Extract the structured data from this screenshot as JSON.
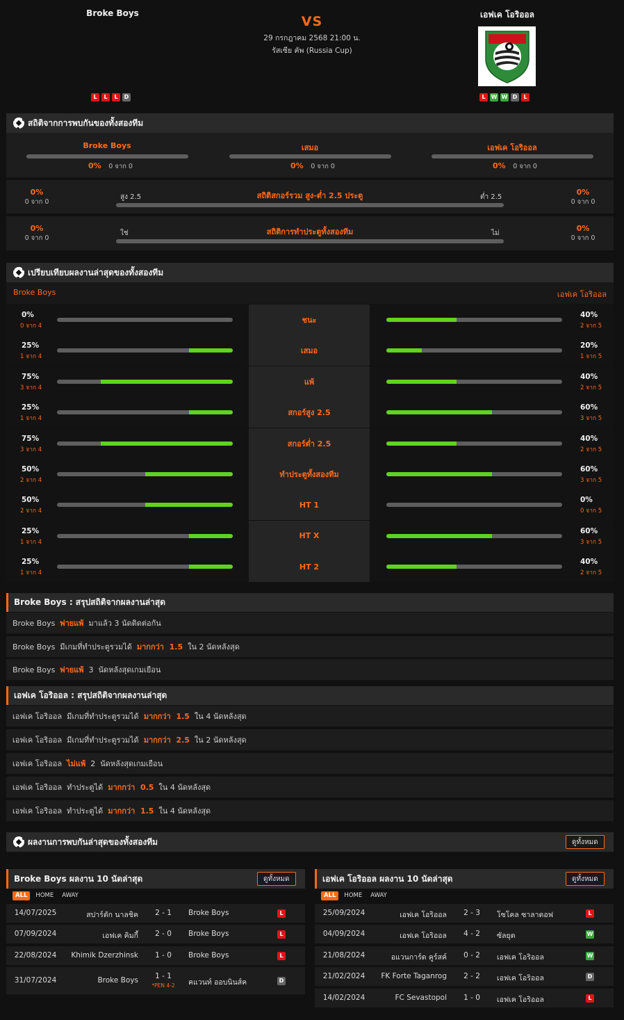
{
  "header": {
    "home_team": "Broke Boys",
    "away_team": "เอฟเค โอริออล",
    "vs": "VS",
    "datetime": "29 กรกฎาคม 2568 21:00 น.",
    "competition": "รัสเซีย คัพ (Russia Cup)",
    "home_form": [
      "L",
      "L",
      "L",
      "D"
    ],
    "away_form": [
      "L",
      "W",
      "W",
      "D",
      "L"
    ]
  },
  "h2h": {
    "title": "สถิติจากการพบกันของทั้งสองทีม",
    "cols": [
      {
        "label": "Broke Boys",
        "pct": "0%",
        "sub": "0 จาก 0",
        "fill": 0
      },
      {
        "label": "เสมอ",
        "pct": "0%",
        "sub": "0 จาก 0",
        "fill": 0
      },
      {
        "label": "เอฟเค โอริออล",
        "pct": "0%",
        "sub": "0 จาก 0",
        "fill": 0
      }
    ],
    "overunder": {
      "title": "สถิติสกอร์รวม สูง-ต่ำ 2.5 ประตู",
      "left_label": "สูง 2.5",
      "right_label": "ต่ำ 2.5",
      "left_pct": "0%",
      "left_sub": "0 จาก 0",
      "right_pct": "0%",
      "right_sub": "0 จาก 0"
    },
    "btts": {
      "title": "สถิติการทำประตูทั้งสองทีม",
      "left_label": "ใช่",
      "right_label": "ไม่",
      "left_pct": "0%",
      "left_sub": "0 จาก 0",
      "right_pct": "0%",
      "right_sub": "0 จาก 0"
    }
  },
  "compare": {
    "title": "เปรียบเทียบผลงานล่าสุดของทั้งสองทีม",
    "home": "Broke Boys",
    "away": "เอฟเค โอริออล",
    "rows": [
      {
        "label": "ชนะ",
        "l_pct": "0%",
        "l_sub": "0 จาก 4",
        "l_fill": 0,
        "r_pct": "40%",
        "r_sub": "2 จาก 5",
        "r_fill": 40
      },
      {
        "label": "เสมอ",
        "l_pct": "25%",
        "l_sub": "1 จาก 4",
        "l_fill": 25,
        "r_pct": "20%",
        "r_sub": "1 จาก 5",
        "r_fill": 20
      },
      {
        "label": "แพ้",
        "l_pct": "75%",
        "l_sub": "3 จาก 4",
        "l_fill": 75,
        "r_pct": "40%",
        "r_sub": "2 จาก 5",
        "r_fill": 40
      },
      {
        "label": "สกอร์สูง 2.5",
        "l_pct": "25%",
        "l_sub": "1 จาก 4",
        "l_fill": 25,
        "r_pct": "60%",
        "r_sub": "3 จาก 5",
        "r_fill": 60
      },
      {
        "label": "สกอร์ต่ำ 2.5",
        "l_pct": "75%",
        "l_sub": "3 จาก 4",
        "l_fill": 75,
        "r_pct": "40%",
        "r_sub": "2 จาก 5",
        "r_fill": 40
      },
      {
        "label": "ทำประตูทั้งสองทีม",
        "l_pct": "50%",
        "l_sub": "2 จาก 4",
        "l_fill": 50,
        "r_pct": "60%",
        "r_sub": "3 จาก 5",
        "r_fill": 60
      },
      {
        "label": "HT 1",
        "l_pct": "50%",
        "l_sub": "2 จาก 4",
        "l_fill": 50,
        "r_pct": "0%",
        "r_sub": "0 จาก 5",
        "r_fill": 0
      },
      {
        "label": "HT X",
        "l_pct": "25%",
        "l_sub": "1 จาก 4",
        "l_fill": 25,
        "r_pct": "60%",
        "r_sub": "3 จาก 5",
        "r_fill": 60
      },
      {
        "label": "HT 2",
        "l_pct": "25%",
        "l_sub": "1 จาก 4",
        "l_fill": 25,
        "r_pct": "40%",
        "r_sub": "2 จาก 5",
        "r_fill": 40
      }
    ]
  },
  "summary_home": {
    "title": "Broke Boys : สรุปสถิติจากผลงานล่าสุด",
    "rows": [
      {
        "a": "Broke Boys  ",
        "b": "พ่ายแพ้",
        "c": "  มาแล้ว 3 นัดติดต่อกัน"
      },
      {
        "a": "Broke Boys  มีเกมที่ทำประตูรวมได้  ",
        "b": "มากกว่า  1.5",
        "c": "  ใน 2 นัดหลังสุด"
      },
      {
        "a": "Broke Boys  ",
        "b": "พ่ายแพ้",
        "c": "  3  นัดหลังสุดเกมเยือน"
      }
    ]
  },
  "summary_away": {
    "title": "เอฟเค โอริออล : สรุปสถิติจากผลงานล่าสุด",
    "rows": [
      {
        "a": "เอฟเค โอริออล  มีเกมที่ทำประตูรวมได้  ",
        "b": "มากกว่า  1.5",
        "c": "  ใน 4 นัดหลังสุด"
      },
      {
        "a": "เอฟเค โอริออล  มีเกมที่ทำประตูรวมได้  ",
        "b": "มากกว่า  2.5",
        "c": "  ใน 2 นัดหลังสุด"
      },
      {
        "a": "เอฟเค โอริออล  ",
        "b": "ไม่แพ้",
        "c": "  2  นัดหลังสุดเกมเยือน"
      },
      {
        "a": "เอฟเค โอริออล  ทำประตูได้  ",
        "b": "มากกว่า  0.5",
        "c": "  ใน 4 นัดหลังสุด"
      },
      {
        "a": "เอฟเค โอริออล  ทำประตูได้  ",
        "b": "มากกว่า  1.5",
        "c": "  ใน 4 นัดหลังสุด"
      }
    ]
  },
  "h2h_results": {
    "title": "ผลงานการพบกันล่าสุดของทั้งสองทีม",
    "view_all": "ดูทั้งหมด"
  },
  "home_results": {
    "title": "Broke Boys ผลงาน 10 นัดล่าสุด",
    "view_all": "ดูทั้งหมด",
    "tabs": [
      "ALL",
      "HOME",
      "AWAY"
    ],
    "matches": [
      {
        "date": "14/07/2025",
        "home": "สปาร์ตัก นาลชิค",
        "score": "2 - 1",
        "away": "Broke Boys",
        "result": "L",
        "pen": ""
      },
      {
        "date": "07/09/2024",
        "home": "เอฟเค คิมกี้",
        "score": "2 - 0",
        "away": "Broke Boys",
        "result": "L",
        "pen": ""
      },
      {
        "date": "22/08/2024",
        "home": "Khimik Dzerzhinsk",
        "score": "1 - 0",
        "away": "Broke Boys",
        "result": "L",
        "pen": ""
      },
      {
        "date": "31/07/2024",
        "home": "Broke Boys",
        "score": "1 - 1",
        "away": "คแวนท์ ออบนินส์ค",
        "result": "D",
        "pen": "*PEN 4-2"
      }
    ]
  },
  "away_results": {
    "title": "เอฟเค โอริออล ผลงาน 10 นัดล่าสุด",
    "view_all": "ดูทั้งหมด",
    "tabs": [
      "ALL",
      "HOME",
      "AWAY"
    ],
    "matches": [
      {
        "date": "25/09/2024",
        "home": "เอฟเค โอริออล",
        "score": "2 - 3",
        "away": "โซโคล ซาลาตอฟ",
        "result": "L"
      },
      {
        "date": "04/09/2024",
        "home": "เอฟเค โอริออล",
        "score": "4 - 2",
        "away": "ซัลยุต",
        "result": "W"
      },
      {
        "date": "21/08/2024",
        "home": "อแวนการ์ด คูร์สค์",
        "score": "0 - 2",
        "away": "เอฟเค โอริออล",
        "result": "W"
      },
      {
        "date": "21/02/2024",
        "home": "FK Forte Taganrog",
        "score": "2 - 2",
        "away": "เอฟเค โอริออล",
        "result": "D"
      },
      {
        "date": "14/02/2024",
        "home": "FC Sevastopol",
        "score": "1 - 0",
        "away": "เอฟเค โอริออล",
        "result": "L"
      }
    ]
  },
  "colors": {
    "accent": "#ff6a1a",
    "win": "#3ca83c",
    "loss": "#e1141b",
    "draw": "#666666",
    "bar_fill": "#5fd31f"
  }
}
